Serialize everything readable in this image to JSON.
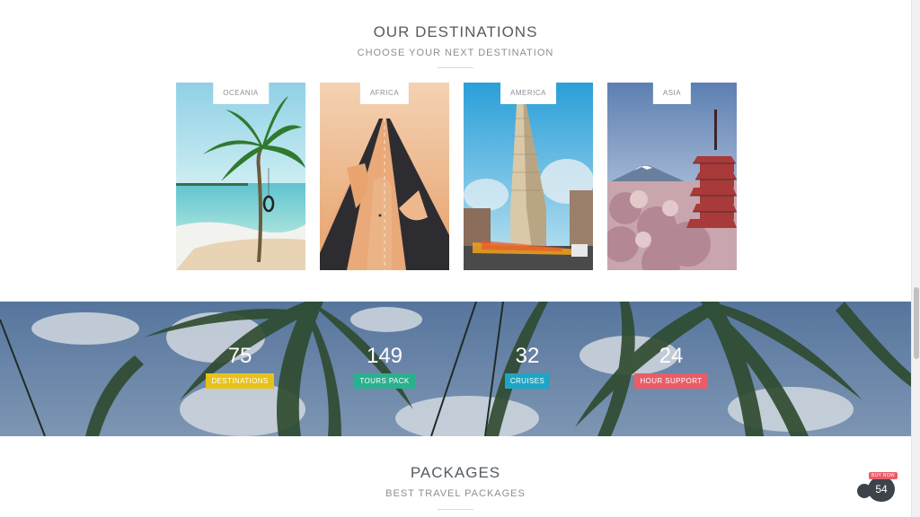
{
  "destinations": {
    "title": "OUR DESTINATIONS",
    "subtitle": "CHOOSE YOUR NEXT DESTINATION",
    "cards": [
      {
        "label": "OCEANIA"
      },
      {
        "label": "AFRICA"
      },
      {
        "label": "AMERICA"
      },
      {
        "label": "ASIA"
      }
    ]
  },
  "stats": [
    {
      "value": "75",
      "label": "DESTINATIONS",
      "color": "#e8c21a"
    },
    {
      "value": "149",
      "label": "TOURS PACK",
      "color": "#2bb08f"
    },
    {
      "value": "32",
      "label": "CRUISES",
      "color": "#1ea5c4"
    },
    {
      "value": "24",
      "label": "HOUR SUPPORT",
      "color": "#e85d69"
    }
  ],
  "packages": {
    "title": "PACKAGES",
    "subtitle": "BEST TRAVEL PACKAGES"
  },
  "buy_widget": {
    "badge": "BUY NOW",
    "count": "54"
  }
}
